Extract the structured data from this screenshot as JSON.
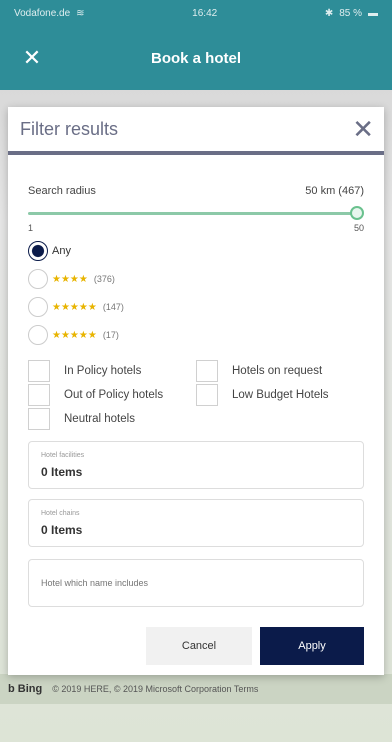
{
  "status_bar": {
    "carrier": "Vodafone.de",
    "time": "16:42",
    "battery": "85 %"
  },
  "header": {
    "title": "Book a hotel",
    "close_glyph": "✕"
  },
  "modal": {
    "title": "Filter results",
    "close_glyph": "✕",
    "search_radius": {
      "label": "Search radius",
      "value_text": "50 km (467)",
      "min_label": "1",
      "max_label": "50",
      "level_fraction": 1.0
    },
    "rating_options": [
      {
        "label": "Any",
        "stars": "",
        "count": "",
        "checked": true
      },
      {
        "label": "",
        "stars": "★★★★",
        "count": "(376)",
        "checked": false
      },
      {
        "label": "",
        "stars": "★★★★★",
        "count": "(147)",
        "checked": false
      },
      {
        "label": "",
        "stars": "★★★★★",
        "count": "(17)",
        "checked": false
      }
    ],
    "checkboxes": [
      {
        "label": "In Policy hotels"
      },
      {
        "label": "Hotels on request"
      },
      {
        "label": "Out of Policy hotels"
      },
      {
        "label": "Low Budget Hotels"
      },
      {
        "label": "Neutral hotels"
      }
    ],
    "hotel_facilities": {
      "label": "Hotel facilities",
      "value": "0 Items"
    },
    "hotel_chains": {
      "label": "Hotel chains",
      "value": "0 Items"
    },
    "name_search": {
      "placeholder": "Hotel which name includes"
    },
    "cancel_label": "Cancel",
    "apply_label": "Apply"
  },
  "map_footer": {
    "brand": "b Bing",
    "copyright": "© 2019 HERE, © 2019 Microsoft Corporation  Terms"
  },
  "colors": {
    "header_bg": "#2e8d98",
    "primary_button": "#0b1b4a",
    "accent_green": "#6ac18e",
    "star_gold": "#e8b400"
  }
}
